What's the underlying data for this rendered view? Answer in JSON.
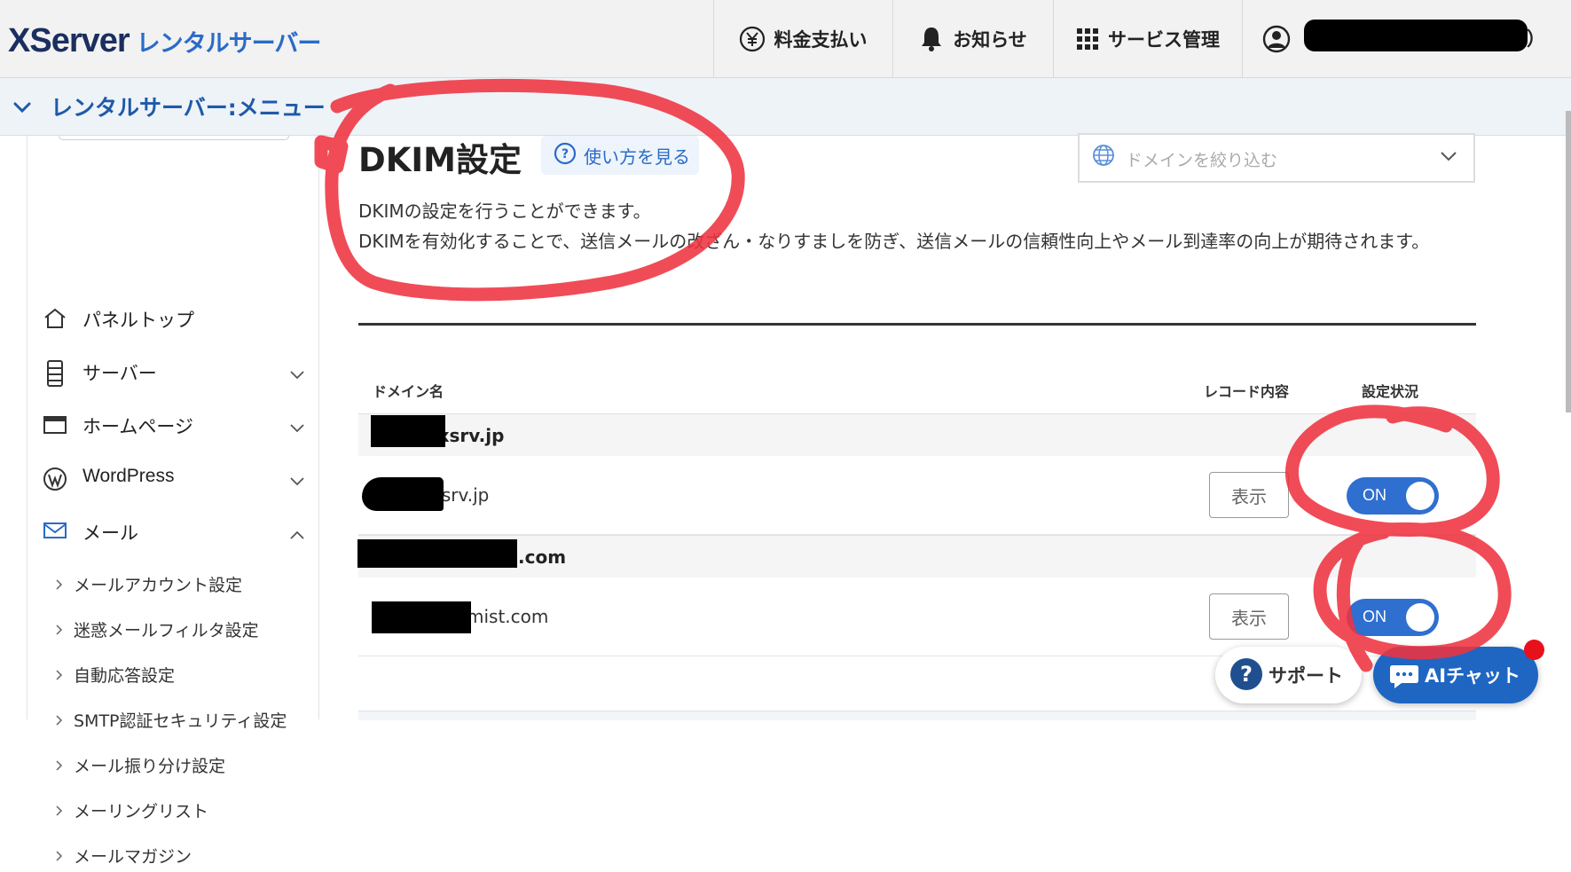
{
  "header": {
    "logo_main": "XServer",
    "logo_sub": "レンタルサーバー",
    "nav": [
      {
        "label": "料金支払い",
        "icon": "yen-icon"
      },
      {
        "label": "お知らせ",
        "icon": "bell-icon"
      },
      {
        "label": "サービス管理",
        "icon": "grid-icon"
      },
      {
        "label": "",
        "icon": "user-icon"
      }
    ],
    "user_suffix": "）"
  },
  "subbar": {
    "title": "レンタルサーバー:メニュー"
  },
  "sidebar": {
    "items": [
      {
        "label": "パネルトップ",
        "icon": "home-icon"
      },
      {
        "label": "サーバー",
        "icon": "server-icon"
      },
      {
        "label": "ホームページ",
        "icon": "window-icon"
      },
      {
        "label": "WordPress",
        "icon": "wordpress-icon"
      },
      {
        "label": "メール",
        "icon": "mail-icon"
      }
    ],
    "mail_sub": [
      "メールアカウント設定",
      "迷惑メールフィルタ設定",
      "自動応答設定",
      "SMTP認証セキュリティ設定",
      "メール振り分け設定",
      "メーリングリスト",
      "メールマガジン"
    ]
  },
  "main": {
    "title": "DKIM設定",
    "help_link": "使い方を見る",
    "filter_placeholder": "ドメインを絞り込む",
    "desc1": "DKIMの設定を行うことができます。",
    "desc2": "DKIMを有効化することで、送信メールの改ざん・なりすましを防ぎ、送信メールの信頼性向上やメール到達率の向上が期待されます。",
    "table": {
      "col_domain": "ドメイン名",
      "col_record": "レコード内容",
      "col_status": "設定状況",
      "groups": [
        {
          "name": ".xsrv.jp",
          "row_name": "xsrv.jp",
          "button": "表示",
          "status": "ON",
          "on": 1
        },
        {
          "name": ".com",
          "row_name": "mist.com",
          "button": "表示",
          "status": "ON",
          "on": 1
        }
      ]
    }
  },
  "widgets": {
    "support": "サポート",
    "ai_chat": "AIチャット"
  },
  "colors": {
    "brand_blue": "#1e5aa8",
    "toggle_on": "#2f6fd0",
    "annotation_red": "#ee3340",
    "badge_red": "#e8101a"
  }
}
